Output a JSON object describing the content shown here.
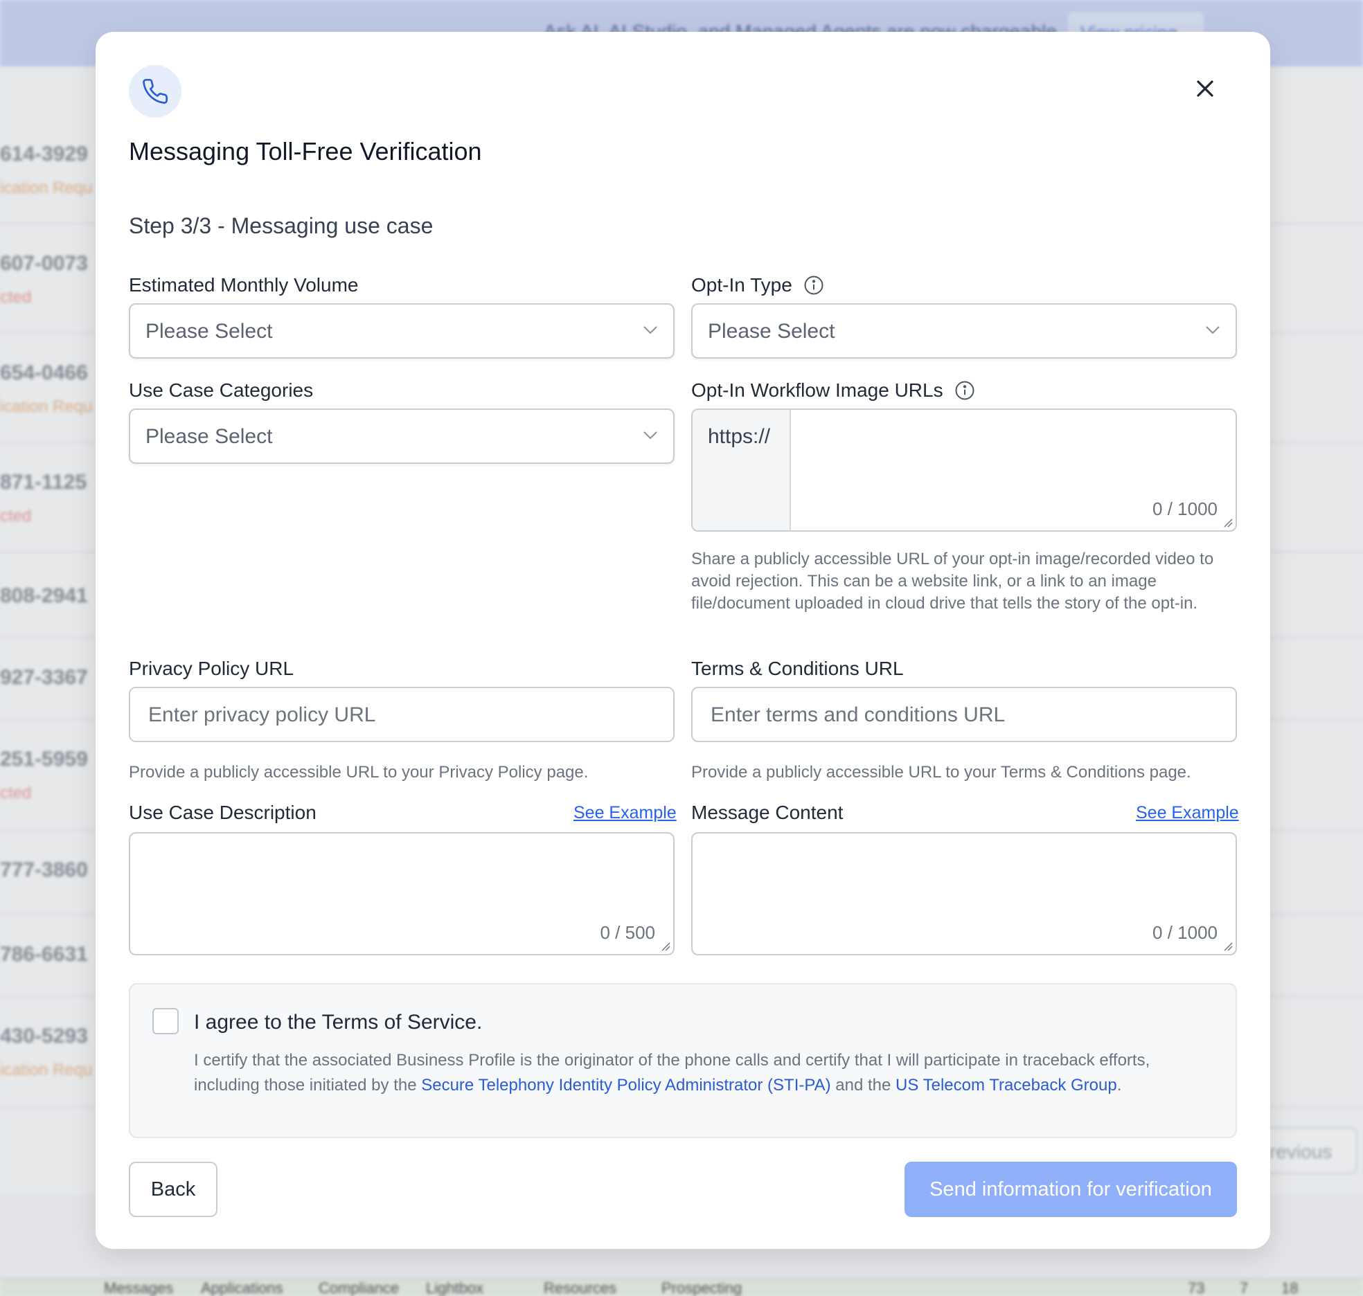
{
  "background": {
    "banner_text": "Ask AI, AI Studio, and Managed Agents are now chargeable",
    "banner_button": "View pricing",
    "rows": [
      {
        "phone": "614-3929",
        "status": "ication Requ",
        "kind": "req"
      },
      {
        "phone": "607-0073",
        "status": "cted",
        "kind": "rej"
      },
      {
        "phone": "654-0466",
        "status": "ication Requ",
        "kind": "req"
      },
      {
        "phone": "871-1125",
        "status": "cted",
        "kind": "rej"
      },
      {
        "phone": "808-2941",
        "status": "",
        "kind": ""
      },
      {
        "phone": "927-3367",
        "status": "",
        "kind": ""
      },
      {
        "phone": "251-5959",
        "status": "cted",
        "kind": "rej"
      },
      {
        "phone": "777-3860",
        "status": "",
        "kind": ""
      },
      {
        "phone": "786-6631",
        "status": "",
        "kind": ""
      },
      {
        "phone": "430-5293",
        "status": "ication Requ",
        "kind": "req"
      }
    ],
    "previous_button": "revious",
    "footer_items": [
      "Messages",
      "Applications",
      "Compliance",
      "Lightbox",
      "Resources",
      "Prospecting"
    ],
    "footer_badges": [
      "73",
      "7",
      "18"
    ]
  },
  "modal": {
    "icon": "phone-icon",
    "close_icon": "close-icon",
    "title": "Messaging Toll-Free Verification",
    "step": "Step 3/3 - Messaging use case",
    "estimated_volume": {
      "label": "Estimated Monthly Volume",
      "placeholder": "Please Select"
    },
    "opt_in_type": {
      "label": "Opt-In Type",
      "placeholder": "Please Select"
    },
    "use_case_categories": {
      "label": "Use Case Categories",
      "placeholder": "Please Select"
    },
    "opt_in_workflow": {
      "label": "Opt-In Workflow Image URLs",
      "prefix": "https://",
      "counter": "0 / 1000",
      "help": "Share a publicly accessible URL of your opt-in image/recorded video to avoid rejection. This can be a website link, or a link to an image file/document uploaded in cloud drive that tells the story of the opt-in."
    },
    "privacy_policy": {
      "label": "Privacy Policy URL",
      "placeholder": "Enter privacy policy URL",
      "help": "Provide a publicly accessible URL to your Privacy Policy page."
    },
    "terms_conditions": {
      "label": "Terms & Conditions URL",
      "placeholder": "Enter terms and conditions URL",
      "help": "Provide a publicly accessible URL to your Terms & Conditions page."
    },
    "use_case_description": {
      "label": "Use Case Description",
      "link": "See Example",
      "counter": "0 / 500"
    },
    "message_content": {
      "label": "Message Content",
      "link": "See Example",
      "counter": "0 / 1000"
    },
    "agreement": {
      "title": "I agree to the Terms of Service.",
      "text_1": "I certify that the associated Business Profile is the originator of the phone calls and certify that I will participate in traceback efforts, including those initiated by the ",
      "link_1": "Secure Telephony Identity Policy Administrator (STI-PA)",
      "text_2": " and the ",
      "link_2": "US Telecom Traceback Group",
      "text_3": "."
    },
    "back_button": "Back",
    "send_button": "Send information for verification"
  }
}
